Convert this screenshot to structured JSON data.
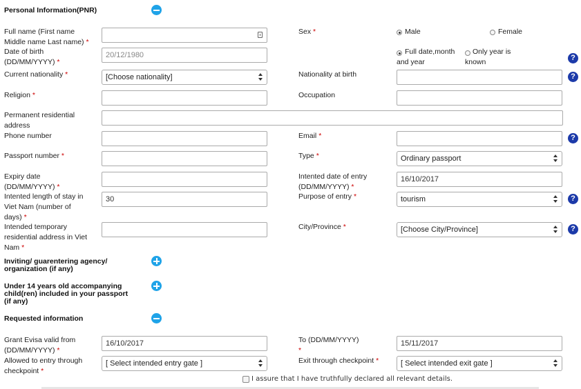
{
  "sections": {
    "personal": "Personal Information(PNR)",
    "inviting": "Inviting/ guarentering agency/ organization (if any)",
    "children": "Under 14 years old accompanying child(ren) included in your passport (if any)",
    "requested": "Requested information"
  },
  "labels": {
    "full_name": "Full name (First name Middle name Last name)",
    "dob": "Date of birth (DD/MM/YYYY)",
    "nationality": "Current nationality",
    "religion": "Religion",
    "permanent_address": "Permanent residential address",
    "phone": "Phone number",
    "passport_number": "Passport number",
    "expiry_date": "Expiry date (DD/MM/YYYY)",
    "length_of_stay": "Intented length of stay in Viet Nam (number of days)",
    "temp_address": "Intended temporary residential address in Viet Nam",
    "sex": "Sex",
    "nationality_birth": "Nationality at birth",
    "occupation": "Occupation",
    "email": "Email",
    "type": "Type",
    "entry_date": "Intented date of entry (DD/MM/YYYY)",
    "purpose": "Purpose of entry",
    "city": "City/Province",
    "evisa_from": "Grant Evisa valid from (DD/MM/YYYY)",
    "entry_through": "Allowed to entry through checkpoint",
    "to": "To (DD/MM/YYYY)",
    "exit_through": "Exit through checkpoint"
  },
  "radios": {
    "male": "Male",
    "female": "Female",
    "full_date": "Full date,month and year",
    "only_year": "Only year is known"
  },
  "values": {
    "dob_placeholder": "20/12/1980",
    "length_of_stay": "30",
    "entry_date": "16/10/2017",
    "evisa_from": "16/10/2017",
    "to": "15/11/2017"
  },
  "selects": {
    "nationality": "[Choose nationality]",
    "type": "Ordinary passport",
    "purpose": "tourism",
    "city": "[Choose City/Province]",
    "entry_gate": "[ Select intended entry gate ]",
    "exit_gate": "[ Select intended exit gate ]"
  },
  "help_glyph": "?",
  "required_mark": "*",
  "assurance": "I assure that I have truthfully declared all relevant details.",
  "colors": {
    "accent": "#1fa3e8",
    "help": "#1c3aa9",
    "required": "#cc0000"
  }
}
